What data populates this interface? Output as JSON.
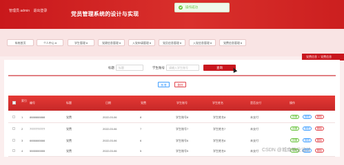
{
  "header": {
    "user_role": "管理员 admin",
    "logout": "退出登录",
    "app_title": "党员管理系统的设计与实现"
  },
  "toast": {
    "message": "操作成功"
  },
  "nav": {
    "items": [
      {
        "label": "系统首页"
      },
      {
        "label": "个人中心 ▾"
      },
      {
        "label": "学生管理 ▾"
      },
      {
        "label": "党建信息管理 ▾"
      },
      {
        "label": "入党申请管理 ▾"
      },
      {
        "label": "党员信息管理 ▾"
      },
      {
        "label": "入党信息管理 ▾"
      },
      {
        "label": "党费信息管理 ▾"
      }
    ]
  },
  "breadcrumb": {
    "home": "党费信息",
    "sep": "/",
    "current": "党费信息"
  },
  "search": {
    "title_label": "标题",
    "title_placeholder": "标题",
    "student_label": "学生账号",
    "student_placeholder": "请输入学生账号",
    "search_button": "查询"
  },
  "actions": {
    "add": "新增",
    "delete": "删除"
  },
  "table": {
    "columns": [
      "编号",
      "索引",
      "标题",
      "日期",
      "党费",
      "学生账号",
      "学生姓名",
      "是否支付",
      "操作"
    ],
    "rows": [
      {
        "index": "1",
        "code": "8888888888",
        "title": "党费",
        "date": "2022-03-06",
        "fee": "8",
        "account": "学生账号8",
        "name": "学生姓名8",
        "paid": "未支付"
      },
      {
        "index": "2",
        "code": "7777777777",
        "title": "党费",
        "date": "2022-03-06",
        "fee": "7",
        "account": "学生账号7",
        "name": "学生姓名7",
        "paid": "未支付"
      },
      {
        "index": "3",
        "code": "6666666666",
        "title": "党费",
        "date": "2022-03-06",
        "fee": "6",
        "account": "学生账号6",
        "name": "学生姓名6",
        "paid": "未支付"
      },
      {
        "index": "4",
        "code": "5555555555",
        "title": "党费",
        "date": "2022-03-06",
        "fee": "5",
        "account": "学生账号5",
        "name": "学生姓名5",
        "paid": "未支付"
      }
    ],
    "row_actions": {
      "detail": "详情",
      "edit": "修改",
      "delete": "删除"
    }
  },
  "watermark": "CSDN @城南毕业设计",
  "colors": {
    "primary": "#c8161d",
    "success": "#67c23a",
    "info": "#409eff",
    "danger": "#e0444b"
  }
}
